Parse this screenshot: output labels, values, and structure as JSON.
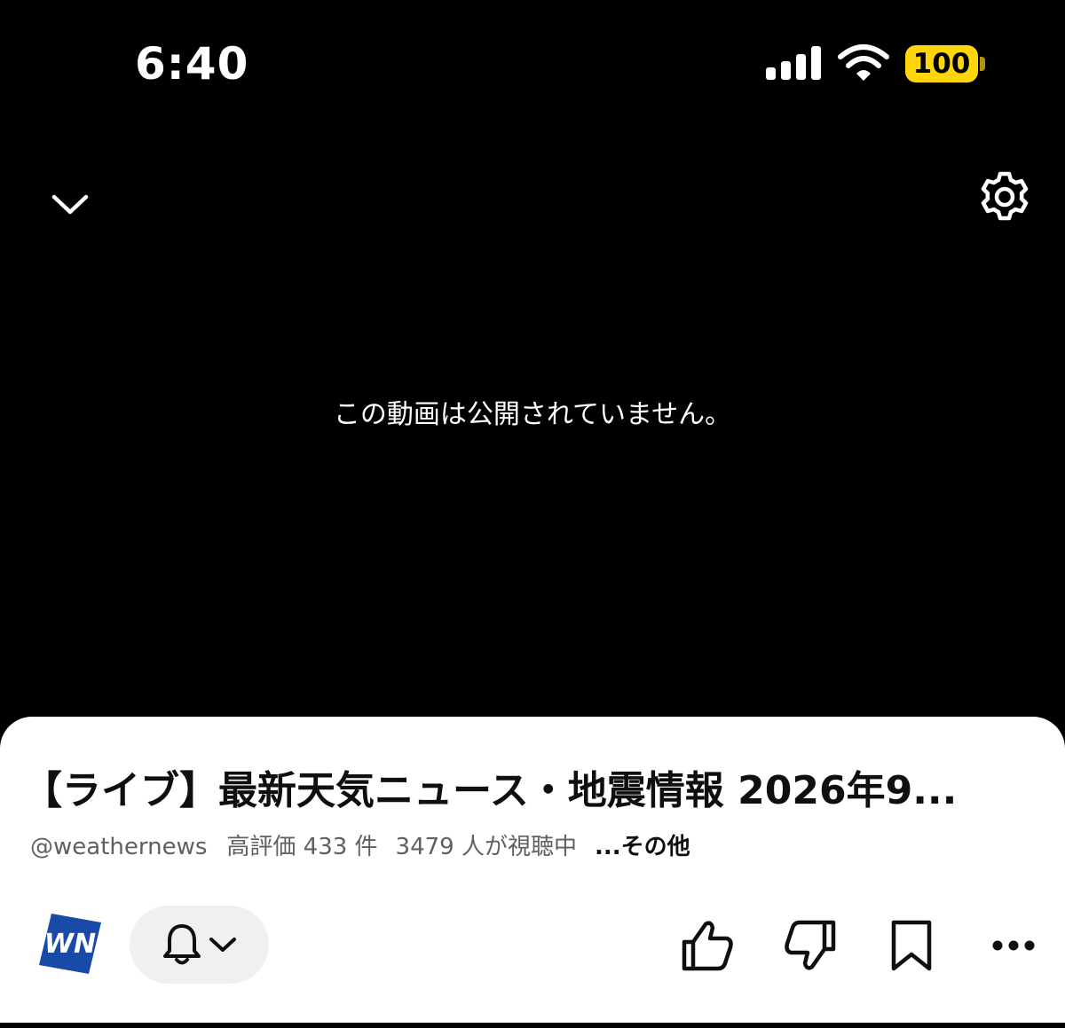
{
  "status_bar": {
    "time": "6:40",
    "battery_level": "100",
    "battery_color": "#ffd60a"
  },
  "player": {
    "unavailable_message": "この動画は公開されていません。",
    "icons": [
      "chevron-down-icon",
      "gear-icon"
    ]
  },
  "video": {
    "title": "【ライブ】最新天気ニュース・地震情報 2026年9...",
    "channel_handle": "@weathernews",
    "likes": "高評価 433 件",
    "viewers": "3479 人が視聴中",
    "more_label": "...その他"
  },
  "channel": {
    "logo_text": "WN",
    "logo_color": "#1a4aa8"
  },
  "actions": {
    "icons": [
      "bell-icon",
      "chevron-down-icon",
      "thumbs-up-icon",
      "thumbs-down-icon",
      "bookmark-icon",
      "more-icon"
    ]
  }
}
